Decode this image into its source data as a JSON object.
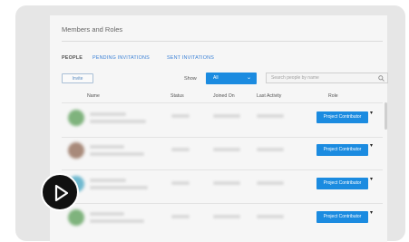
{
  "panel": {
    "title": "Members and Roles"
  },
  "tabs": [
    {
      "label": "PEOPLE",
      "active": true
    },
    {
      "label": "PENDING INVITATIONS",
      "active": false
    },
    {
      "label": "SENT INVITATIONS",
      "active": false
    }
  ],
  "toolbar": {
    "invite_label": "Invite",
    "show_label": "Show",
    "show_value": "All",
    "search_placeholder": "Search people by name"
  },
  "table": {
    "columns": [
      "Name",
      "Status",
      "Joined On",
      "Last Activity",
      "Role"
    ],
    "rows": [
      {
        "role": "Project Contributor",
        "avatar_color": "#7fb37d"
      },
      {
        "role": "Project Contributor",
        "avatar_color": "#a88a7a"
      },
      {
        "role": "Project Contributor",
        "avatar_color": "#6fb9cf"
      },
      {
        "role": "Project Contributor",
        "avatar_color": "#7fb37d"
      }
    ]
  },
  "colors": {
    "accent": "#1b8be0",
    "tab_link": "#3d82d6",
    "play_button": "#111111"
  },
  "icons": {
    "search": "search-icon",
    "play": "play-icon",
    "chevron": "chevron-down-icon"
  }
}
